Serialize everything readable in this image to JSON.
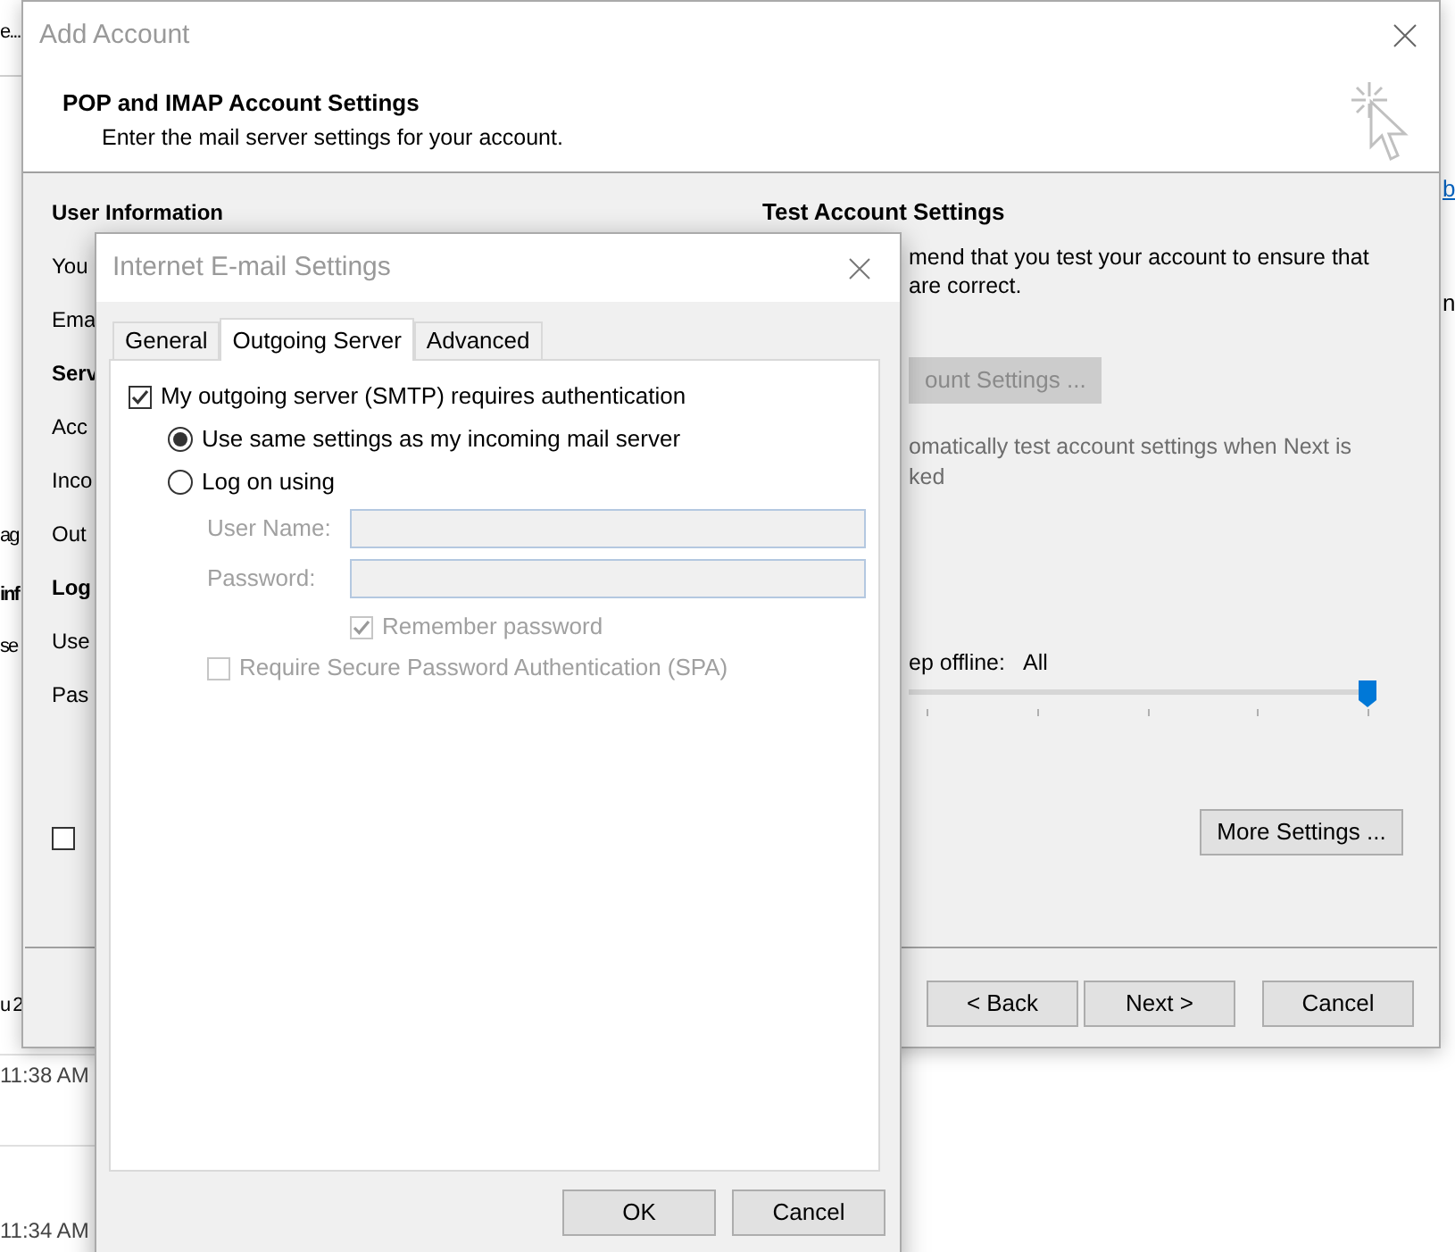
{
  "background_app": {
    "left_fragments": [
      {
        "text": "e...",
        "bold": false
      },
      {
        "text": "ag",
        "bold": false
      },
      {
        "text": "inf",
        "bold": true
      },
      {
        "text": "se",
        "bold": false
      },
      {
        "text": "u 2",
        "bold": false
      }
    ],
    "times": [
      "11:38 AM",
      "11:34 AM"
    ],
    "right_fragments": [
      {
        "text": "b",
        "kind": "link"
      },
      {
        "text": "n",
        "kind": "text"
      }
    ]
  },
  "add_account": {
    "title": "Add Account",
    "heading": "POP and IMAP Account Settings",
    "subtitle": "Enter the mail server settings for your account.",
    "left_labels": [
      {
        "text": "User Information",
        "bold": true
      },
      {
        "text": "You",
        "bold": false
      },
      {
        "text": "Ema",
        "bold": false
      },
      {
        "text": "Serv",
        "bold": true
      },
      {
        "text": "Acc",
        "bold": false
      },
      {
        "text": "Inco",
        "bold": false
      },
      {
        "text": "Out",
        "bold": false
      },
      {
        "text": "Log",
        "bold": true
      },
      {
        "text": "Use",
        "bold": false
      },
      {
        "text": "Pas",
        "bold": false
      }
    ],
    "left_checkbox": {
      "checked": false
    },
    "test": {
      "title": "Test Account Settings",
      "description": [
        "mend that you test your account to ensure that",
        "are correct."
      ],
      "test_button": {
        "label": "ount Settings ...",
        "disabled": true
      },
      "auto_test": [
        "omatically test account settings when Next is",
        "ked"
      ]
    },
    "offline": {
      "label": "ep offline:",
      "value": "All",
      "level": 1
    },
    "more_settings": "More Settings ...",
    "buttons": [
      "< Back",
      "Next >",
      "Cancel"
    ]
  },
  "dialog": {
    "title": "Internet E-mail Settings",
    "tabs": [
      {
        "label": "General",
        "selected": false
      },
      {
        "label": "Outgoing Server",
        "selected": true
      },
      {
        "label": "Advanced",
        "selected": false
      }
    ],
    "auth": {
      "label": "My outgoing server (SMTP) requires authentication",
      "checked": true
    },
    "options": [
      {
        "label": "Use same settings as my incoming mail server",
        "selected": true
      },
      {
        "label": "Log on using",
        "selected": false
      }
    ],
    "fields": [
      {
        "label": "User Name:",
        "disabled": true
      },
      {
        "label": "Password:",
        "disabled": true
      }
    ],
    "remember": {
      "label": "Remember password",
      "checked": true,
      "disabled": true
    },
    "spa": {
      "label": "Require Secure Password Authentication (SPA)",
      "checked": false,
      "disabled": true
    },
    "buttons": [
      "OK",
      "Cancel"
    ]
  }
}
